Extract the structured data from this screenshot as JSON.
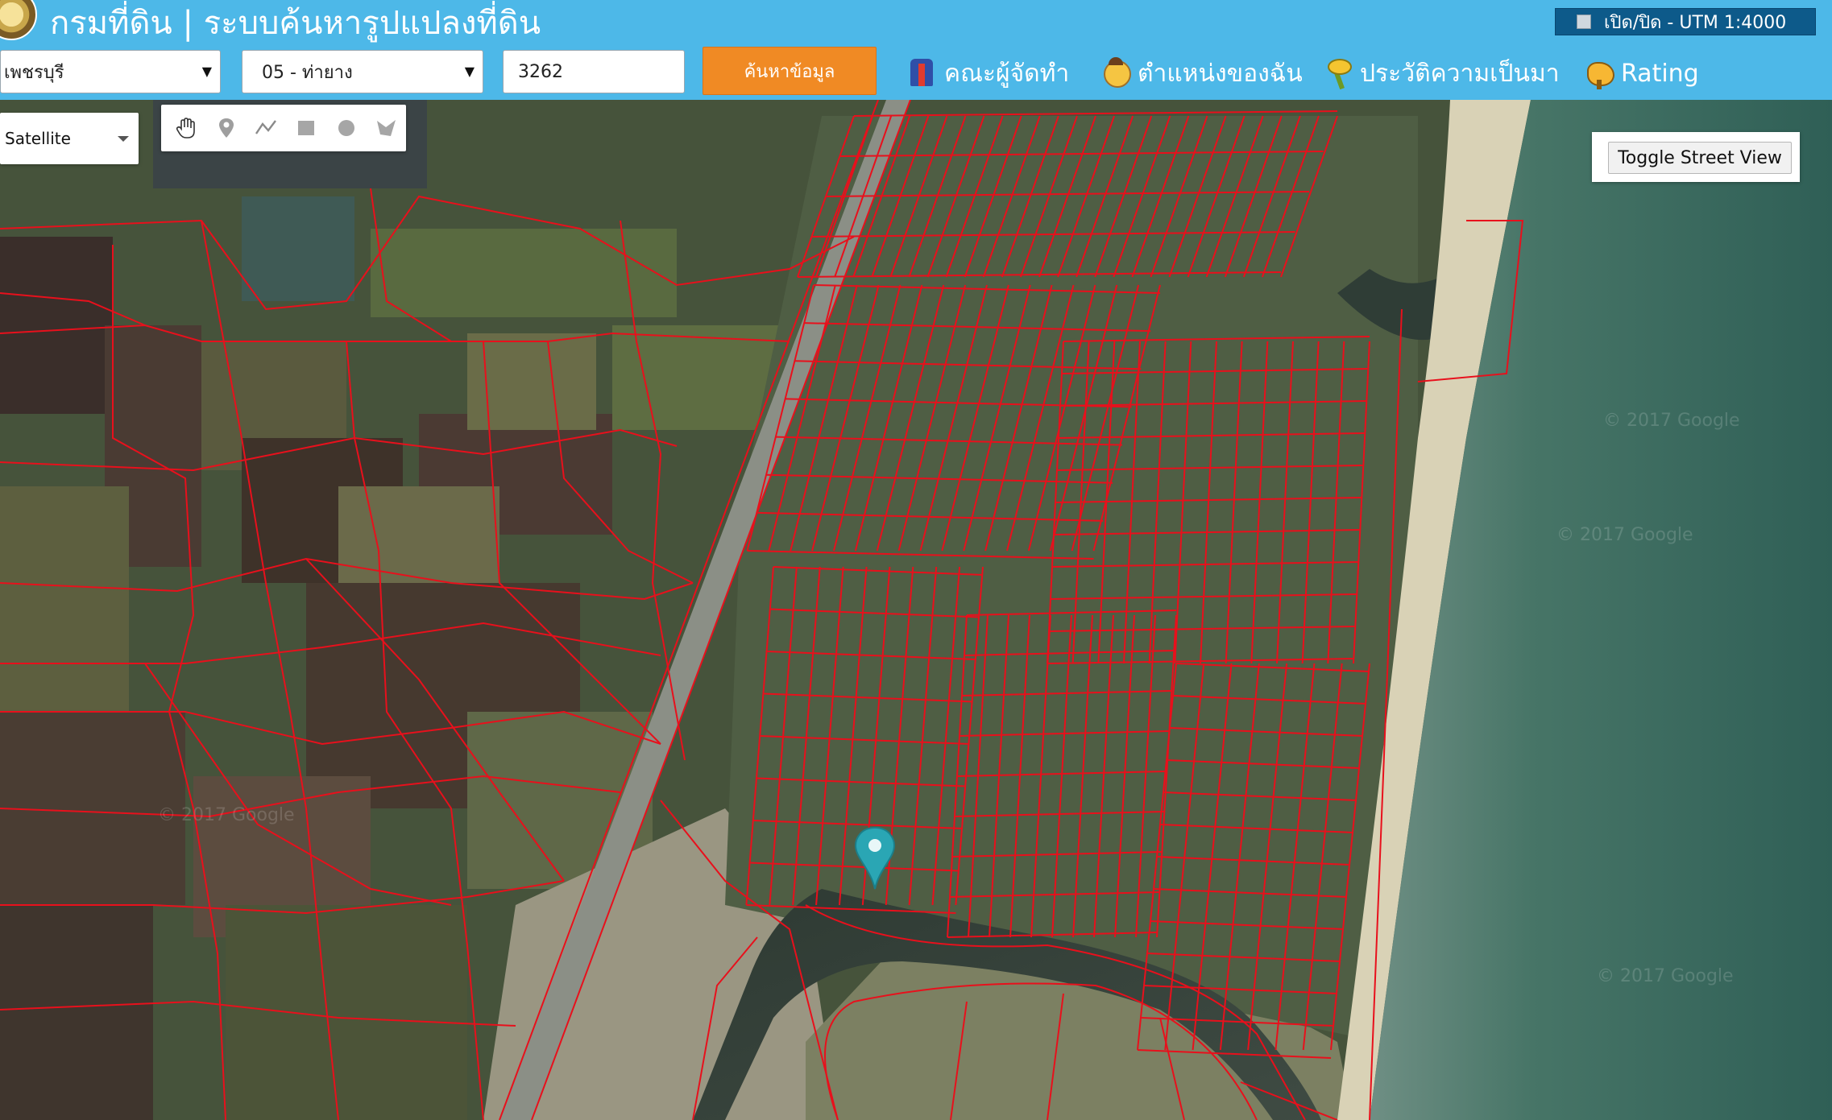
{
  "header": {
    "title": "กรมที่ดิน | ระบบค้นหารูปแปลงที่ดิน",
    "utm_toggle_label": "เปิด/ปิด - UTM 1:4000"
  },
  "search": {
    "province": "เพชรบุรี",
    "district": "05 - ท่ายาง",
    "parcel_number": "3262",
    "button_label": "ค้นหาข้อมูล"
  },
  "nav": {
    "team": "คณะผู้จัดทำ",
    "my_location": "ตำแหน่งของฉัน",
    "history": "ประวัติความเป็นมา",
    "rating": "Rating"
  },
  "map": {
    "map_type": "Satellite",
    "street_view_button": "Toggle Street View",
    "watermark": "© 2017 Google",
    "parcel_line_color": "#e8101c",
    "marker_color": "#2aa6b4",
    "tools": [
      "hand-pan-icon",
      "marker-icon",
      "polyline-icon",
      "rectangle-icon",
      "circle-icon",
      "polygon-icon"
    ]
  },
  "colors": {
    "header_bg": "#4db8e8",
    "search_button_bg": "#f08a24",
    "utm_toggle_bg": "#0d5a8a"
  }
}
